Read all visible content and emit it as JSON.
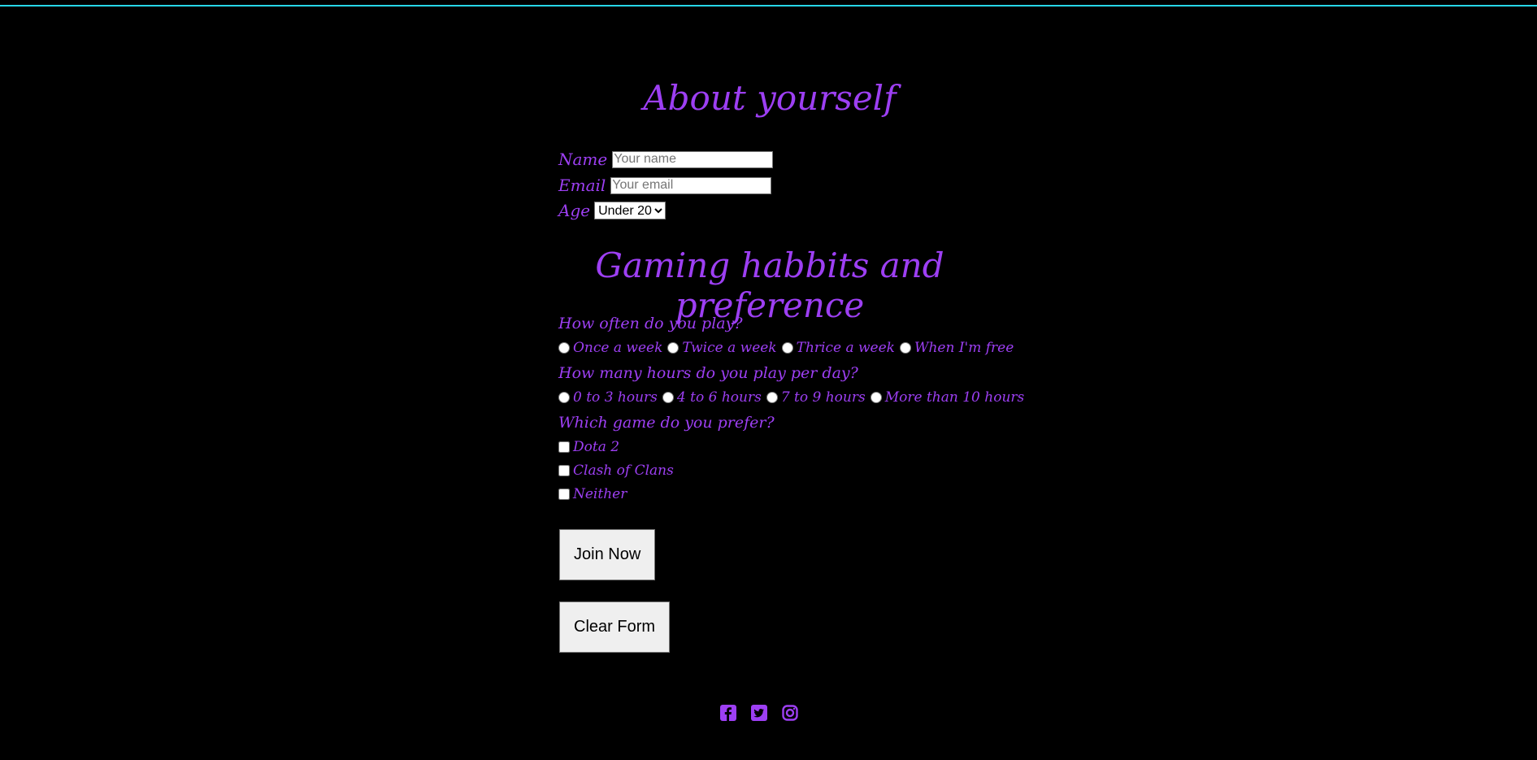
{
  "about": {
    "title": "About yourself",
    "name_label": "Name",
    "name_placeholder": "Your name",
    "email_label": "Email",
    "email_placeholder": "Your email",
    "age_label": "Age",
    "age_selected": "Under 20"
  },
  "gaming": {
    "title": "Gaming habbits and preference",
    "frequency": {
      "question": "How often do you play?",
      "options": [
        "Once a week",
        "Twice a week",
        "Thrice a week",
        "When I'm free"
      ]
    },
    "hours": {
      "question": "How many hours do you play per day?",
      "options": [
        "0 to 3 hours",
        "4 to 6 hours",
        "7 to 9 hours",
        "More than 10 hours"
      ]
    },
    "games": {
      "question": "Which game do you prefer?",
      "options": [
        "Dota 2",
        "Clash of Clans",
        "Neither"
      ]
    }
  },
  "buttons": {
    "join": "Join Now",
    "clear": "Clear Form"
  },
  "social": {
    "icons": [
      "facebook-icon",
      "twitter-icon",
      "instagram-icon"
    ],
    "color": "#9d3ff3"
  },
  "colors": {
    "background": "#000000",
    "accent": "#9d3ff3",
    "top_line": "#27d6e8"
  }
}
